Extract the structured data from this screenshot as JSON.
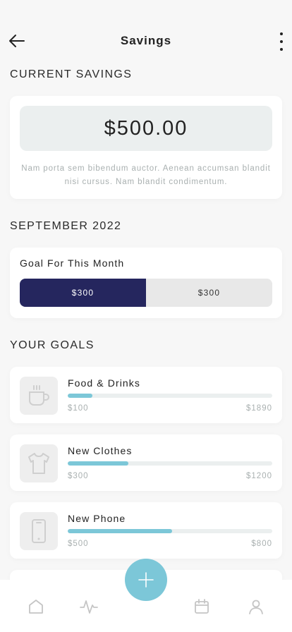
{
  "header": {
    "title": "Savings",
    "back_icon": "arrow-left-icon",
    "more_icon": "more-vertical-icon"
  },
  "current_savings": {
    "section_label": "CURRENT SAVINGS",
    "amount": "$500.00",
    "description": "Nam porta sem bibendum auctor. Aenean accumsan blandit nisi cursus. Nam blandit condimentum."
  },
  "month": {
    "section_label": "SEPTEMBER 2022",
    "goal_title": "Goal For This Month",
    "options": [
      {
        "label": "$300",
        "active": true
      },
      {
        "label": "$300",
        "active": false
      }
    ]
  },
  "goals": {
    "section_label": "YOUR GOALS",
    "items": [
      {
        "name": "Food & Drinks",
        "icon": "coffee-cup-icon",
        "min": "$100",
        "max": "$1890",
        "progress": 0.12
      },
      {
        "name": "New Clothes",
        "icon": "shirt-icon",
        "min": "$300",
        "max": "$1200",
        "progress": 0.295
      },
      {
        "name": "New Phone",
        "icon": "phone-icon",
        "min": "$500",
        "max": "$800",
        "progress": 0.51
      }
    ]
  },
  "tabbar": {
    "items": [
      {
        "icon": "home-icon"
      },
      {
        "icon": "activity-icon"
      },
      {
        "icon": "calendar-icon"
      },
      {
        "icon": "user-icon"
      }
    ],
    "fab_icon": "plus-icon"
  },
  "colors": {
    "accent": "#7cc7d8",
    "primary_dark": "#25265e",
    "muted_text": "#a9b0b0",
    "background": "#f7f7f7"
  }
}
